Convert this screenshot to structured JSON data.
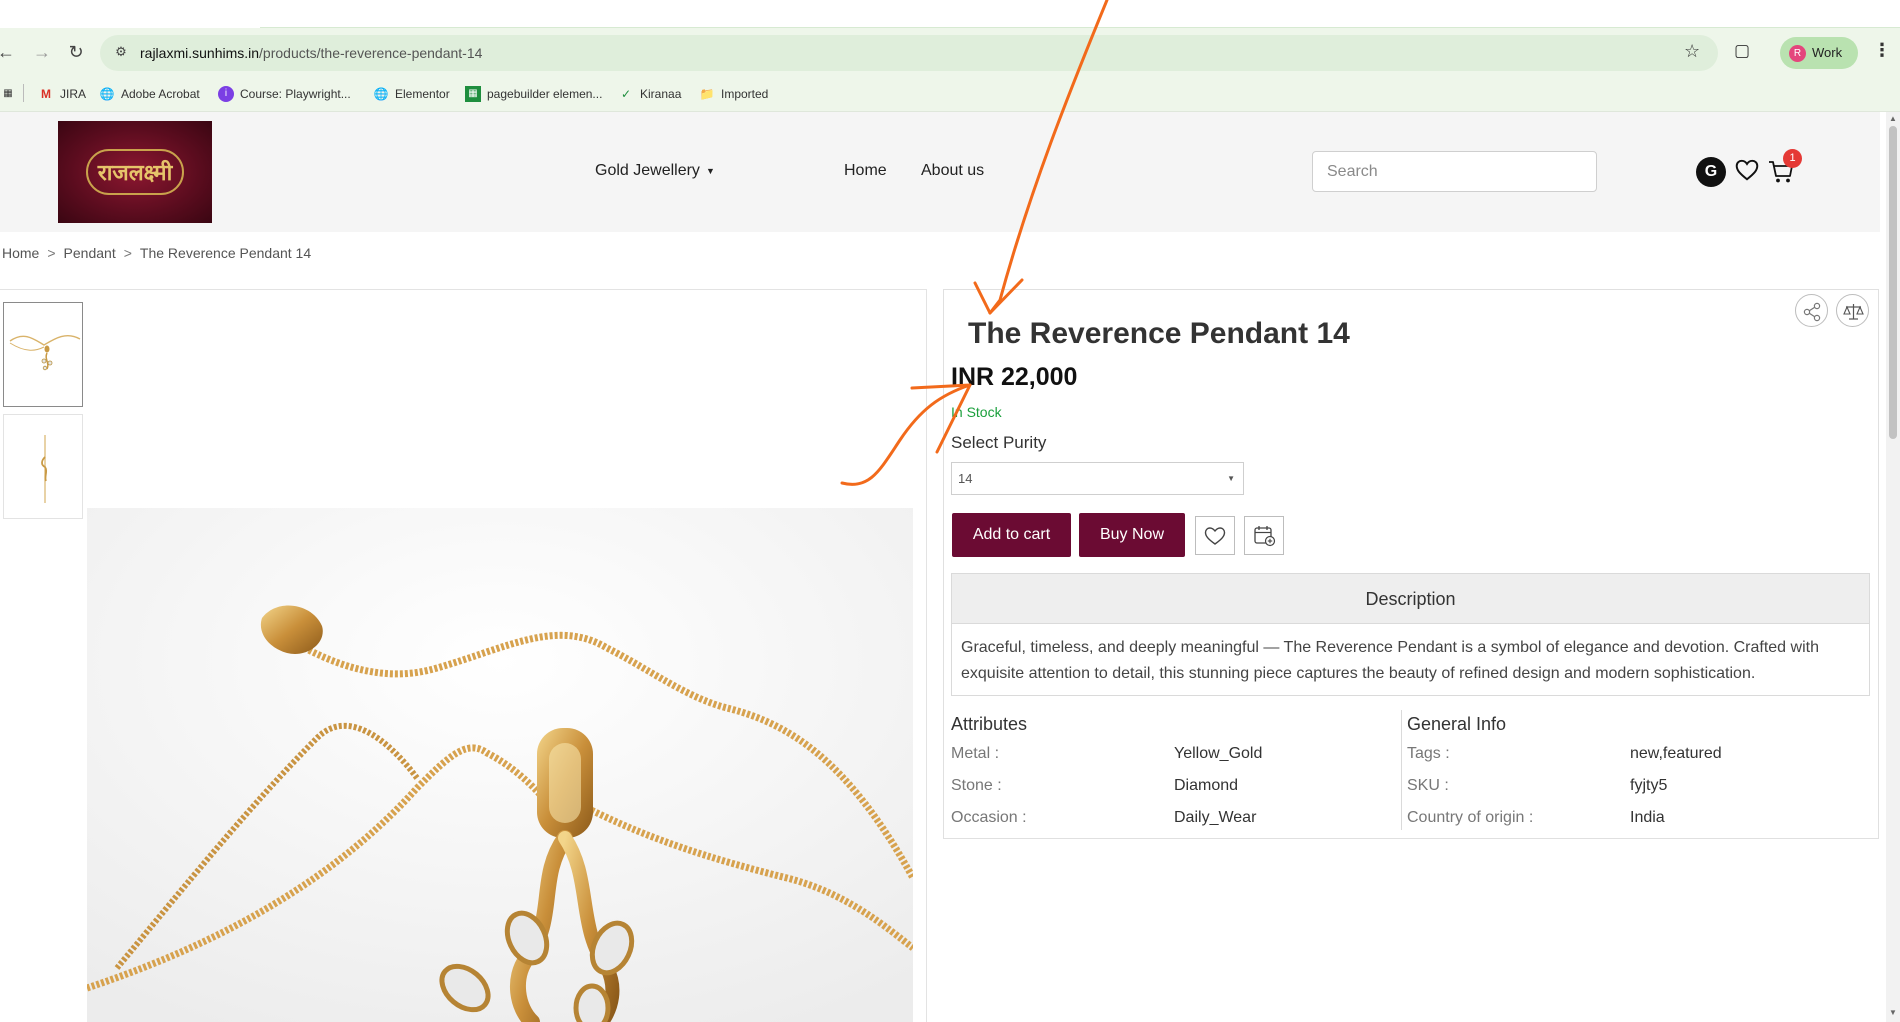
{
  "browser": {
    "url_host": "rajlaxmi.sunhims.in",
    "url_path": "/products/the-reverence-pendant-14",
    "profile_initial": "R",
    "profile_label": "Work",
    "accent_color": "#b9e2b0"
  },
  "bookmarks": [
    {
      "label": "JIRA",
      "icon": "gmail-icon"
    },
    {
      "label": "Adobe Acrobat",
      "icon": "globe-icon"
    },
    {
      "label": "Course: Playwright...",
      "icon": "course-icon"
    },
    {
      "label": "Elementor",
      "icon": "globe-icon"
    },
    {
      "label": "pagebuilder elemen...",
      "icon": "sheets-icon"
    },
    {
      "label": "Kiranaa",
      "icon": "check-icon"
    },
    {
      "label": "Imported",
      "icon": "folder-icon"
    }
  ],
  "header": {
    "logo_text": "राजलक्ष्मी",
    "nav": {
      "gold_jewellery": "Gold Jewellery",
      "home": "Home",
      "about": "About us"
    },
    "search_placeholder": "Search",
    "user_initial": "G",
    "cart_count": "1",
    "brand_color": "#6b0b33"
  },
  "breadcrumb": {
    "home": "Home",
    "category": "Pendant",
    "current": "The Reverence Pendant 14",
    "separator": ">"
  },
  "product": {
    "title": "The Reverence Pendant 14",
    "price": "INR 22,000",
    "stock": "In Stock",
    "stock_color": "#1a9f3c",
    "purity_label": "Select Purity",
    "purity_selected": "14",
    "add_to_cart": "Add to cart",
    "buy_now": "Buy Now",
    "description_heading": "Description",
    "description": "Graceful, timeless, and deeply meaningful — The Reverence Pendant is a symbol of elegance and devotion. Crafted with exquisite attention to detail, this stunning piece captures the beauty of refined design and modern sophistication."
  },
  "attributes": {
    "heading": "Attributes",
    "rows": [
      {
        "key": "Metal :",
        "value": "Yellow_Gold"
      },
      {
        "key": "Stone :",
        "value": "Diamond"
      },
      {
        "key": "Occasion :",
        "value": "Daily_Wear"
      }
    ]
  },
  "general_info": {
    "heading": "General Info",
    "rows": [
      {
        "key": "Tags :",
        "value": "new,featured"
      },
      {
        "key": "SKU :",
        "value": "fyjty5"
      },
      {
        "key": "Country of origin :",
        "value": "India"
      }
    ]
  },
  "annotation_color": "#f26a1b"
}
